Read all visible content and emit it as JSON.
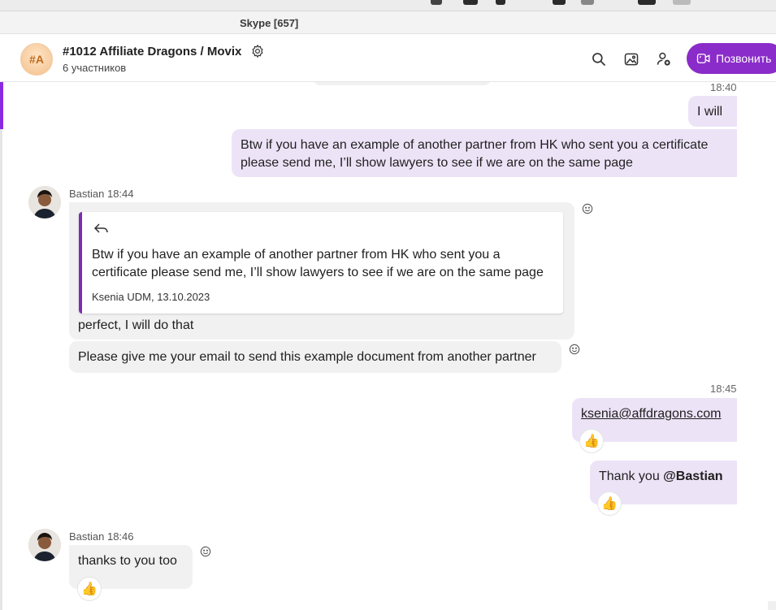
{
  "window": {
    "title": "Skype [657]"
  },
  "chat": {
    "avatar_initials": "#A",
    "title": "#1012 Affiliate Dragons / Movix",
    "subtitle": "6 участников",
    "call_label": "Позвонить"
  },
  "icons": [
    "gear-icon",
    "search-icon",
    "gallery-icon",
    "add-person-icon",
    "video-call-icon",
    "smiley-icon",
    "reply-icon",
    "thumbs-up-icon"
  ],
  "colors": {
    "accent": "#8a2cc9",
    "outgoing_bubble": "#ede3f7",
    "incoming_bubble": "#f1f1f1"
  },
  "messages": {
    "m1": {
      "time": "18:40",
      "text": "I will"
    },
    "m2": {
      "text": "Btw if you have an example of another partner from HK who sent you a certificate please send me, I’ll show lawyers to see if we are on the same page"
    },
    "m3": {
      "sender": "Bastian 18:44",
      "quote_text": "Btw if you have an example of another partner from HK who sent you a certificate please send me, I’ll show lawyers to see if we are on the same page",
      "quote_meta": "Ksenia UDM, 13.10.2023",
      "text": "perfect, I will do that"
    },
    "m4": {
      "text": "Please give me your email to send this example document from another partner"
    },
    "m5": {
      "time": "18:45",
      "text": "ksenia@affdragons.com",
      "reaction": "👍"
    },
    "m6": {
      "text_plain": "Thank you ",
      "mention": "@Bastian",
      "reaction": "👍"
    },
    "m7": {
      "sender": "Bastian 18:46",
      "text": "thanks to you too",
      "reaction": "👍"
    }
  }
}
